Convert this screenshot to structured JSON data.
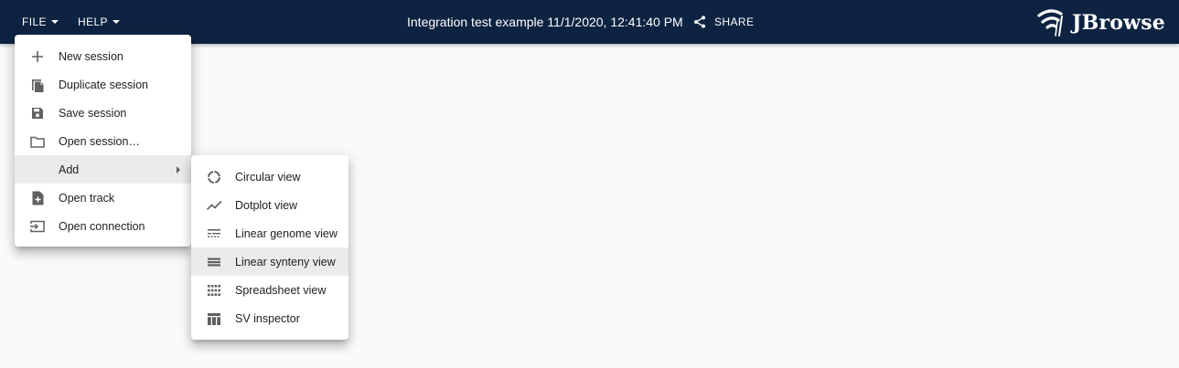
{
  "appbar": {
    "file_label": "FILE",
    "help_label": "HELP",
    "session_title": "Integration test example 11/1/2020, 12:41:40 PM",
    "share_label": "SHARE",
    "logo_text": "JBrowse",
    "background_color": "#0d2341"
  },
  "file_menu": {
    "items": [
      {
        "label": "New session",
        "icon": "plus-icon"
      },
      {
        "label": "Duplicate session",
        "icon": "file-copy-icon"
      },
      {
        "label": "Save session",
        "icon": "save-icon"
      },
      {
        "label": "Open session…",
        "icon": "folder-icon"
      },
      {
        "label": "Add",
        "icon": "",
        "submenu": true
      },
      {
        "label": "Open track",
        "icon": "note-add-icon"
      },
      {
        "label": "Open connection",
        "icon": "input-icon"
      }
    ]
  },
  "add_menu": {
    "items": [
      {
        "label": "Circular view",
        "icon": "circular-view-icon"
      },
      {
        "label": "Dotplot view",
        "icon": "dotplot-icon"
      },
      {
        "label": "Linear genome view",
        "icon": "linear-genome-icon"
      },
      {
        "label": "Linear synteny view",
        "icon": "linear-synteny-icon"
      },
      {
        "label": "Spreadsheet view",
        "icon": "spreadsheet-icon"
      },
      {
        "label": "SV inspector",
        "icon": "sv-inspector-icon"
      }
    ]
  }
}
